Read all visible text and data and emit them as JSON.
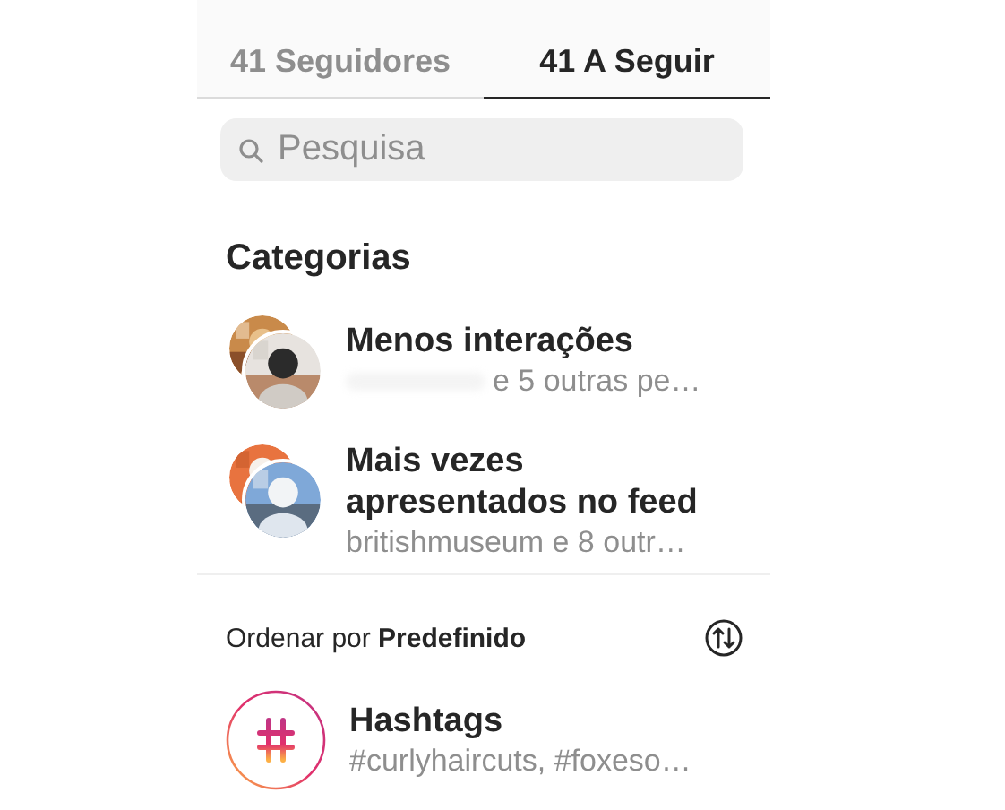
{
  "tabs": [
    {
      "label": "41 Seguidores",
      "selected": false
    },
    {
      "label": "41 A Seguir",
      "selected": true
    }
  ],
  "search": {
    "placeholder": "Pesquisa"
  },
  "categories_heading": "Categorias",
  "categories": [
    {
      "title": "Menos interações",
      "subtitle": "e 5 outras pe…",
      "redacted": true
    },
    {
      "title": "Mais vezes apresentados no feed",
      "subtitle": "britishmuseum e 8 outr…",
      "redacted": false
    }
  ],
  "sort": {
    "label": "Ordenar por **Predefinido**"
  },
  "hashtags": {
    "title": "Hashtags",
    "subtitle": "#curlyhaircuts, #foxeso…"
  }
}
